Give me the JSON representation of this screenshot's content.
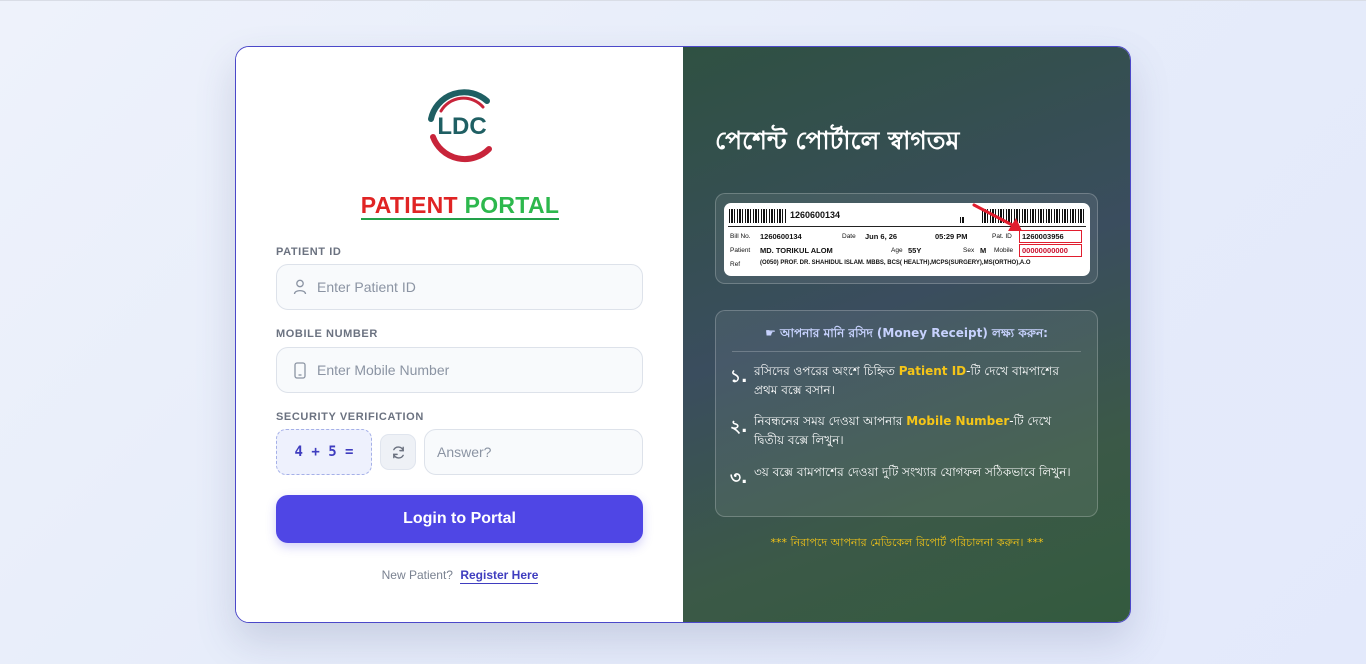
{
  "colors": {
    "accent": "#4f46e5",
    "title_red": "#e02424",
    "title_green": "#2db84d",
    "highlight": "#f5c518",
    "panel_dark": "#34503f"
  },
  "logo": {
    "text": "LDC",
    "icon": "ldc-logo"
  },
  "portal_title": {
    "word1": "PATIENT",
    "word2": "PORTAL"
  },
  "form": {
    "patient_id": {
      "label": "PATIENT ID",
      "placeholder": "Enter Patient ID",
      "value": "",
      "icon": "user-icon"
    },
    "mobile": {
      "label": "MOBILE NUMBER",
      "placeholder": "Enter Mobile Number",
      "value": "",
      "icon": "phone-icon"
    },
    "security": {
      "label": "SECURITY VERIFICATION",
      "question": "4 + 5 =",
      "answer_placeholder": "Answer?",
      "refresh_icon": "refresh-icon"
    },
    "login_label": "Login to Portal",
    "new_patient_text": "New Patient?",
    "register_label": "Register Here"
  },
  "right": {
    "welcome": "পেশেন্ট পোর্টালে স্বাগতম",
    "receipt": {
      "bill_barcode_num": "1260600134",
      "bill_no_label": "Bill No.",
      "bill_no": "1260600134",
      "date_label": "Date",
      "date": "Jun 6, 26",
      "time": "05:29 PM",
      "pat_id_label": "Pat. ID",
      "pat_id": "1260003956",
      "patient_label": "Patient",
      "patient_name": "MD. TORIKUL ALOM",
      "age_label": "Age",
      "age": "55Y",
      "sex_label": "Sex",
      "sex": "M",
      "mobile_label": "Mobile",
      "mobile": "00000000000",
      "ref_label": "Ref",
      "ref": "(O050) PROF. DR. SHAHIDUL ISLAM. MBBS, BCS( HEALTH),MCPS(SURGERY),MS(ORTHO),A.O"
    },
    "instructions": {
      "heading": "☛ আপনার মানি রসিদ (Money Receipt) লক্ষ্য করুন:",
      "steps": [
        {
          "num": "১.",
          "before": "রসিদের ওপরের অংশে চিহ্নিত ",
          "highlight": "Patient ID",
          "after": "-টি দেখে বামপাশের প্রথম বক্সে বসান।"
        },
        {
          "num": "২.",
          "before": "নিবন্ধনের সময় দেওয়া আপনার ",
          "highlight": "Mobile Number",
          "after": "-টি দেখে দ্বিতীয় বক্সে লিখুন।"
        },
        {
          "num": "৩.",
          "before": "৩য় বক্সে বামপাশের দেওয়া দুটি সংখ্যার যোগফল সঠিকভাবে লিখুন।",
          "highlight": "",
          "after": ""
        }
      ]
    },
    "footer_note": "*** নিরাপদে আপনার মেডিকেল রিপোর্ট পরিচালনা করুন। ***"
  }
}
